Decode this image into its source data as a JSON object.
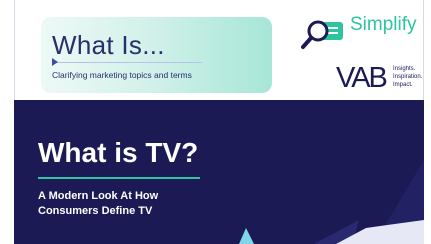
{
  "header": {
    "title": "What Is...",
    "subtitle": "Clarifying marketing topics and terms"
  },
  "logos": {
    "simplify": {
      "name": "Simplify",
      "icon": "magnifier-icon",
      "color": "#2cc5a0"
    },
    "vab": {
      "wordmark": "VAB",
      "tagline_1": "Insights.",
      "tagline_2": "Inspiration.",
      "tagline_3": "Impact."
    }
  },
  "hero": {
    "title": "What is TV?",
    "subtitle_line_1": "A Modern Look At How",
    "subtitle_line_2": "Consumers Define TV",
    "background": "#1b1a55",
    "accent": "#2fc4a6"
  }
}
